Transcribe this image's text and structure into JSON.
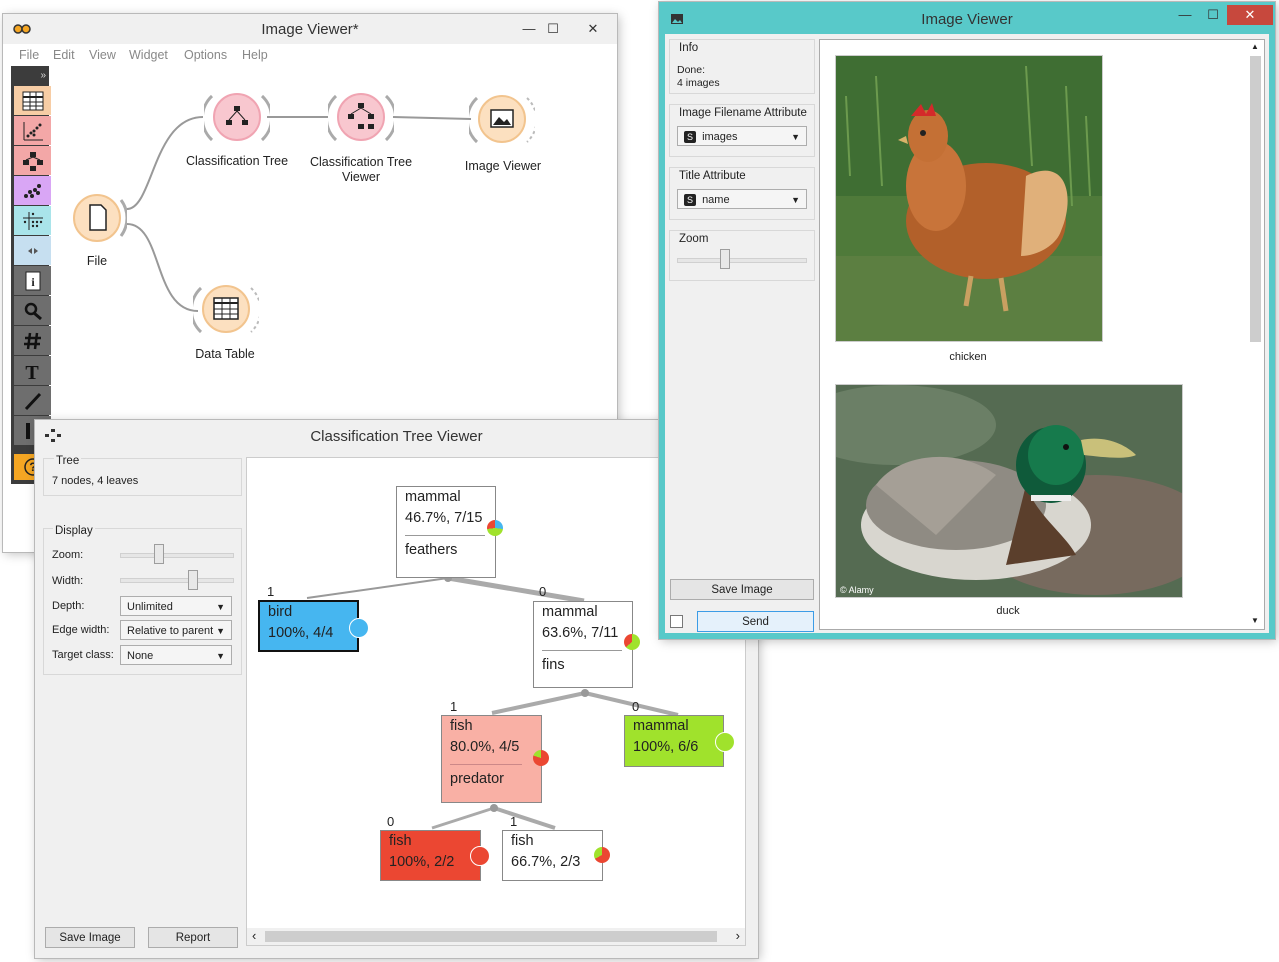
{
  "canvas_window": {
    "title": "Image Viewer*",
    "menu": [
      "File",
      "Edit",
      "View",
      "Widget",
      "Options",
      "Help"
    ],
    "minimize_glyph": "—",
    "maximize_glyph": "☐",
    "close_glyph": "✕",
    "collapse_glyph": "»",
    "help_glyph": "?",
    "widgets": {
      "file": "File",
      "classification_tree": "Classification Tree",
      "tree_viewer_line1": "Classification Tree",
      "tree_viewer_line2": "Viewer",
      "image_viewer": "Image Viewer",
      "data_table": "Data Table"
    },
    "toolbox_icons": [
      "data-table-icon",
      "scatter-plot-icon",
      "tree-icon",
      "scatter-colored-icon",
      "grid-icon",
      "arrows-icon",
      "info-icon",
      "search-icon",
      "hash-icon",
      "text-icon",
      "pen-icon",
      "pause-icon",
      "help-icon"
    ]
  },
  "tree_viewer_window": {
    "title": "Classification Tree Viewer",
    "tree_box": {
      "title": "Tree",
      "info": "7 nodes, 4 leaves"
    },
    "display_box": {
      "title": "Display",
      "zoom_label": "Zoom:",
      "zoom_level": 0.33,
      "width_label": "Width:",
      "width_level": 0.63,
      "depth_label": "Depth:",
      "depth_value": "Unlimited",
      "edge_width_label": "Edge width:",
      "edge_width_value": "Relative to parent",
      "target_class_label": "Target class:",
      "target_class_value": "None"
    },
    "buttons": {
      "save": "Save Image",
      "report": "Report"
    },
    "scroll_left": "‹",
    "scroll_right": "›",
    "combo_arrow": "▼",
    "tree_nodes": [
      {
        "id": "root",
        "class": "mammal",
        "stat": "46.7%, 7/15",
        "split": "feathers",
        "color": "#ffffff"
      },
      {
        "id": "bird",
        "class": "bird",
        "stat": "100%, 4/4",
        "color": "#46b6f0"
      },
      {
        "id": "n-mammal",
        "class": "mammal",
        "stat": "63.6%, 7/11",
        "split": "fins",
        "color": "#ffffff"
      },
      {
        "id": "n-fish",
        "class": "fish",
        "stat": "80.0%, 4/5",
        "split": "predator",
        "color": "#f9b0a5"
      },
      {
        "id": "mammal-leaf",
        "class": "mammal",
        "stat": "100%, 6/6",
        "color": "#a0e22c"
      },
      {
        "id": "fish-leaf-red",
        "class": "fish",
        "stat": "100%, 2/2",
        "color": "#eb4732"
      },
      {
        "id": "fish-leaf-white",
        "class": "fish",
        "stat": "66.7%, 2/3",
        "color": "#ffffff"
      }
    ],
    "edge_labels": [
      "1",
      "0",
      "1",
      "0",
      "0",
      "1"
    ],
    "colors": {
      "bird": "#46b6f0",
      "fish": "#eb4732",
      "mammal": "#a0e22c"
    }
  },
  "image_viewer_window": {
    "title": "Image Viewer",
    "minimize_glyph": "—",
    "maximize_glyph": "☐",
    "close_glyph": "✕",
    "info_box": {
      "title": "Info",
      "line1": "Done:",
      "line2": "4 images"
    },
    "filename_box": {
      "title": "Image Filename Attribute",
      "badge": "S",
      "value": "images"
    },
    "title_box": {
      "title": "Title Attribute",
      "badge": "S",
      "value": "name"
    },
    "zoom_box": {
      "title": "Zoom",
      "level": 0.33
    },
    "combo_arrow": "▼",
    "scroll_up": "▲",
    "scroll_down": "▼",
    "buttons": {
      "save": "Save Image",
      "send": "Send"
    },
    "images": [
      {
        "caption": "chicken"
      },
      {
        "caption": "duck",
        "watermark": "© Alamy"
      }
    ]
  }
}
